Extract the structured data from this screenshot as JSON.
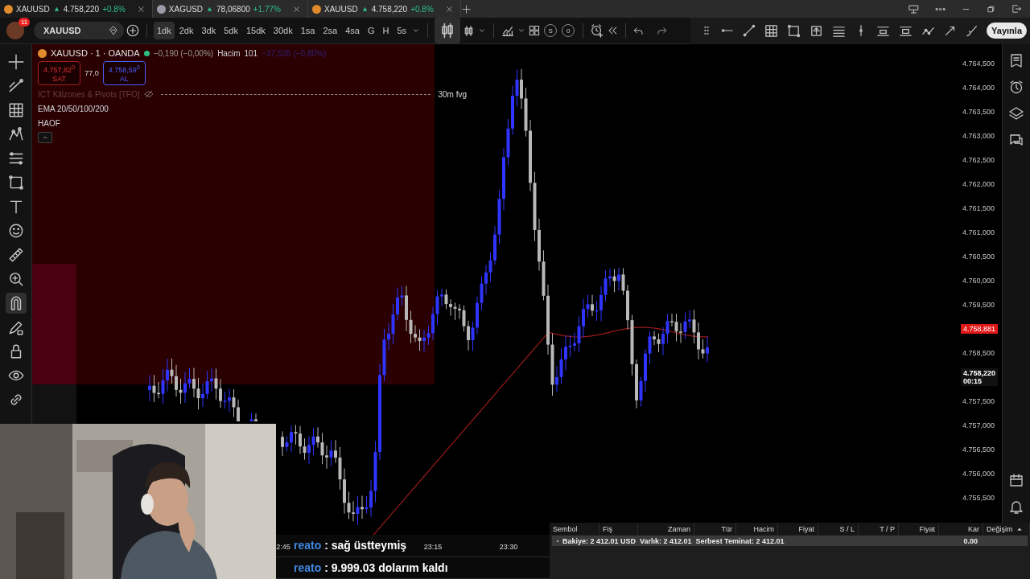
{
  "tabs": [
    {
      "symbol": "XAUUSD",
      "price": "4.758,220",
      "change": "+0.8%",
      "color": "#e08a2c",
      "selected": true
    },
    {
      "symbol": "XAGUSD",
      "price": "78,06800",
      "change": "+1.77%",
      "color": "#9a9aa8",
      "selected": false
    },
    {
      "symbol": "XAUUSD",
      "price": "4.758,220",
      "change": "+0.8%",
      "color": "#e08a2c",
      "selected": false
    }
  ],
  "toolbar": {
    "notifications": "11",
    "symbol": "XAUUSD",
    "intervals": [
      {
        "label": "1dk",
        "selected": true
      },
      {
        "label": "2dk",
        "selected": false
      },
      {
        "label": "3dk",
        "selected": false
      },
      {
        "label": "5dk",
        "selected": false
      },
      {
        "label": "15dk",
        "selected": false
      },
      {
        "label": "30dk",
        "selected": false
      },
      {
        "label": "1sa",
        "selected": false
      },
      {
        "label": "2sa",
        "selected": false
      },
      {
        "label": "4sa",
        "selected": false
      },
      {
        "label": "G",
        "selected": false
      },
      {
        "label": "H",
        "selected": false
      },
      {
        "label": "5s",
        "selected": false
      }
    ],
    "badges": [
      "S",
      "0"
    ],
    "publish": "Yayınla"
  },
  "left_tools": [
    {
      "kind": "crosshair",
      "selected": false
    },
    {
      "kind": "trendline",
      "selected": false
    },
    {
      "kind": "grid",
      "selected": false
    },
    {
      "kind": "pattern",
      "selected": false
    },
    {
      "kind": "fib",
      "selected": false
    },
    {
      "kind": "rect",
      "selected": false
    },
    {
      "kind": "text",
      "selected": false
    },
    {
      "kind": "smiley",
      "selected": false
    },
    {
      "kind": "ruler",
      "selected": false
    },
    {
      "kind": "zoom",
      "selected": false
    },
    {
      "kind": "magnet",
      "selected": true
    },
    {
      "kind": "pencillock",
      "selected": false
    },
    {
      "kind": "lock",
      "selected": false
    },
    {
      "kind": "eye",
      "selected": false
    },
    {
      "kind": "link",
      "selected": false
    }
  ],
  "legend": {
    "title": "XAUUSD · 1 · OANDA",
    "market_open": true,
    "change": "−0,190 (−0,00%)",
    "volume_label": "Hacim",
    "volume": "101",
    "volume_change": "−37,535 (−0,80%)",
    "sell": {
      "price": "4.757,82$^{0}$",
      "label": "SAT"
    },
    "spread": "77,0",
    "buy": {
      "price": "4.758,59$^{0}$",
      "label": "AL"
    },
    "indicators": [
      {
        "name": "ICT Killzones & Pivots [TFO]",
        "hidden": true
      },
      {
        "name": "EMA 20/50/100/200",
        "hidden": false
      },
      {
        "name": "HAOF",
        "hidden": false
      }
    ],
    "zone_label": "30m fvg"
  },
  "price_axis": [
    {
      "kind": "tick",
      "text": "4.764,500"
    },
    {
      "kind": "tick",
      "text": "4.764,000"
    },
    {
      "kind": "tick",
      "text": "4.763,500"
    },
    {
      "kind": "tick",
      "text": "4.763,000"
    },
    {
      "kind": "tick",
      "text": "4.762,500"
    },
    {
      "kind": "tick",
      "text": "4.762,000"
    },
    {
      "kind": "tick",
      "text": "4.761,500"
    },
    {
      "kind": "tick",
      "text": "4.761,000"
    },
    {
      "kind": "tick",
      "text": "4.760,500"
    },
    {
      "kind": "tick",
      "text": "4.760,000"
    },
    {
      "kind": "tick",
      "text": "4.759,500"
    },
    {
      "kind": "last_price",
      "text": "4.758,881"
    },
    {
      "kind": "tick",
      "text": "4.758,500"
    },
    {
      "kind": "countdown",
      "text": "4.758,220",
      "time": "00:15"
    },
    {
      "kind": "tick",
      "text": "4.757,500"
    },
    {
      "kind": "tick",
      "text": "4.757,000"
    },
    {
      "kind": "tick",
      "text": "4.756,500"
    },
    {
      "kind": "tick",
      "text": "4.756,000"
    },
    {
      "kind": "tick",
      "text": "4.755,500"
    }
  ],
  "time_axis": [
    "2:45",
    "23:15",
    "23:30"
  ],
  "chat": [
    {
      "user": "reato",
      "message": ": sağ üstteymiş"
    },
    {
      "user": "reato",
      "message": ": 9.999.03 dolarım kaldı"
    }
  ],
  "positions": {
    "columns": [
      {
        "label": "Sembol",
        "sorted": false
      },
      {
        "label": "Fiş",
        "sorted": false
      },
      {
        "label": "Zaman",
        "sorted": false
      },
      {
        "label": "Tür",
        "sorted": false
      },
      {
        "label": "Hacim",
        "sorted": false
      },
      {
        "label": "Fiyat",
        "sorted": false
      },
      {
        "label": "S / L",
        "sorted": false
      },
      {
        "label": "T / P",
        "sorted": false
      },
      {
        "label": "Fiyat",
        "sorted": false
      },
      {
        "label": "Kar",
        "sorted": false
      },
      {
        "label": "Değişim",
        "sorted": true
      }
    ],
    "account": "Bakiye: 2 412.01 USD  Varlık: 2 412.01  Serbest Teminat: 2 412.01",
    "profit": "0.00"
  }
}
